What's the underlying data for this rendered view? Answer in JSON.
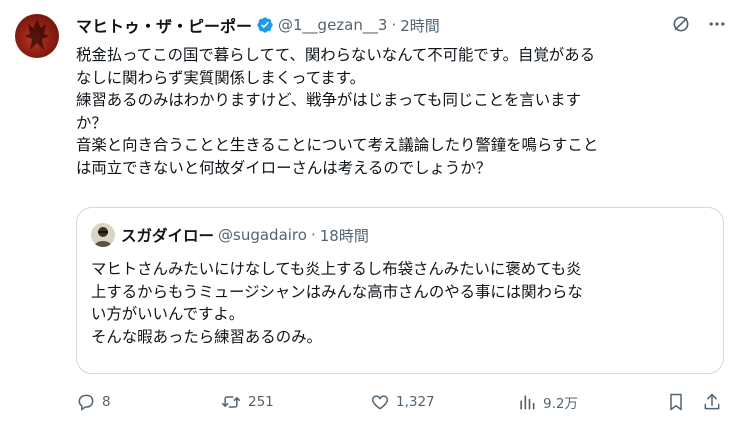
{
  "tweet": {
    "author_name": "マヒトゥ・ザ・ピーポー",
    "handle": "@1__gezan__3",
    "separator": "·",
    "time": "2時間",
    "lines": [
      "税金払ってこの国で暮らしてて、関わらないなんて不可能です。自覚がある",
      "なしに関わらず実質関係しまくってます。",
      "練習あるのみはわかりますけど、戦争がはじまっても同じことを言います",
      "か？",
      "音楽と向き合うことと生きることについて考え議論したり警鐘を鳴らすこと",
      "は両立できないと何故ダイローさんは考えるのでしょうか？"
    ]
  },
  "quoted": {
    "author_name": "スガダイロー",
    "handle": "@sugadairo",
    "separator": "·",
    "time": "18時間",
    "lines": [
      "マヒトさんみたいにけなしても炎上するし布袋さんみたいに褒めても炎",
      "上するからもうミュージシャンはみんな高市さんのやる事には関わらな",
      "い方がいいんですよ。",
      "そんな暇あったら練習あるのみ。"
    ]
  },
  "actions": {
    "replies": "8",
    "reposts": "251",
    "likes": "1,327",
    "views": "9.2万"
  },
  "icons": {
    "verified": "verified-badge-icon",
    "grok": "grok-icon",
    "more": "more-icon",
    "reply": "reply-icon",
    "repost": "repost-icon",
    "like": "heart-icon",
    "views": "views-icon",
    "bookmark": "bookmark-icon",
    "share": "share-icon"
  },
  "colors": {
    "text": "#0f1419",
    "secondary": "#536471",
    "verified": "#1d9bf0",
    "border": "#cfd9de"
  }
}
